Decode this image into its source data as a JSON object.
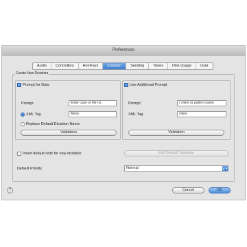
{
  "window": {
    "title": "Preferences"
  },
  "tabs": [
    {
      "label": "Audio"
    },
    {
      "label": "Controllers"
    },
    {
      "label": "Hot-Keys"
    },
    {
      "label": "Creation"
    },
    {
      "label": "Sending"
    },
    {
      "label": "Tones"
    },
    {
      "label": "Disk Usage"
    },
    {
      "label": "User"
    }
  ],
  "active_tab": "Creation",
  "section": {
    "title": "Create New Dictation"
  },
  "left_panel": {
    "prompt_for_data": {
      "label": "Prompt for Data",
      "checked": true
    },
    "prompt_label": "Prompt",
    "prompt_value": "Enter case or file no.",
    "xml_tag_label": "XML Tag",
    "xml_tag_value": "fileno",
    "replace_label": "Replace Default Dictation Name",
    "validation_button": "Validation"
  },
  "right_panel": {
    "use_additional_prompt": {
      "label": "Use Additional Prompt",
      "checked": true
    },
    "prompt_label": "Prompt",
    "prompt_value": "r client or patient name",
    "xml_tag_label": "XML Tag",
    "xml_tag_value": "client",
    "validation_button": "Validation"
  },
  "insert_default_note": {
    "label": "Insert default note for new dictation",
    "checked": false
  },
  "edit_default_template_button": "Edit Default Template",
  "default_priority": {
    "label": "Default Priority",
    "value": "Normal"
  },
  "footer": {
    "help": "?",
    "cancel": "Cancel",
    "ok": "OK"
  },
  "colors": {
    "accent": "#3d7fd2",
    "window_bg": "#e4e4e4"
  },
  "icons": {
    "help": "help-icon",
    "select_arrow": "updown-arrows-icon"
  }
}
